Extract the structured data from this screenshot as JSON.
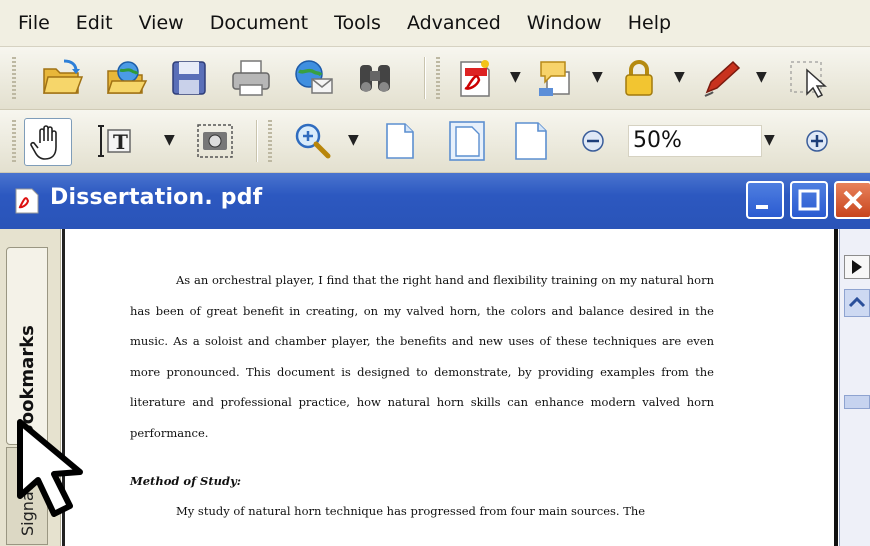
{
  "menu": [
    "File",
    "Edit",
    "View",
    "Document",
    "Tools",
    "Advanced",
    "Window",
    "Help"
  ],
  "toolbar_icons_row1": [
    "open-icon",
    "web-open-icon",
    "save-icon",
    "print-icon",
    "email-icon",
    "search-binoculars-icon",
    "create-pdf-icon",
    "comment-icon",
    "secure-lock-icon",
    "sign-pen-icon",
    "select-tool-icon"
  ],
  "toolbar_icons_row2": [
    "hand-tool-icon",
    "select-text-icon",
    "snapshot-icon",
    "zoom-in-icon",
    "actual-size-icon",
    "fit-page-icon",
    "fit-width-icon",
    "zoom-out-circle-icon",
    "zoom-in-circle-icon"
  ],
  "zoom": {
    "value": "50%"
  },
  "document": {
    "title": "Dissertation. pdf",
    "paragraph1": "As an orchestral player, I find that the right hand and flexibility training on my natural horn has been of great benefit in creating, on my valved horn, the colors and balance desired in the music.  As a soloist and chamber player, the benefits and new uses of these techniques are even more pronounced.  This document is designed to demonstrate, by providing examples from the literature and professional practice, how natural horn skills can enhance modern valved horn performance.",
    "heading": "Method of Study:",
    "paragraph2": "My study of natural horn technique has progressed from four main sources.  The"
  },
  "nav_tabs": {
    "bookmarks": "Bookmarks",
    "signatures": "Signatures"
  },
  "colors": {
    "titlebar": "#2c58c0",
    "close_button": "#c8451e",
    "toolbar_bg": "#ece9d8"
  }
}
